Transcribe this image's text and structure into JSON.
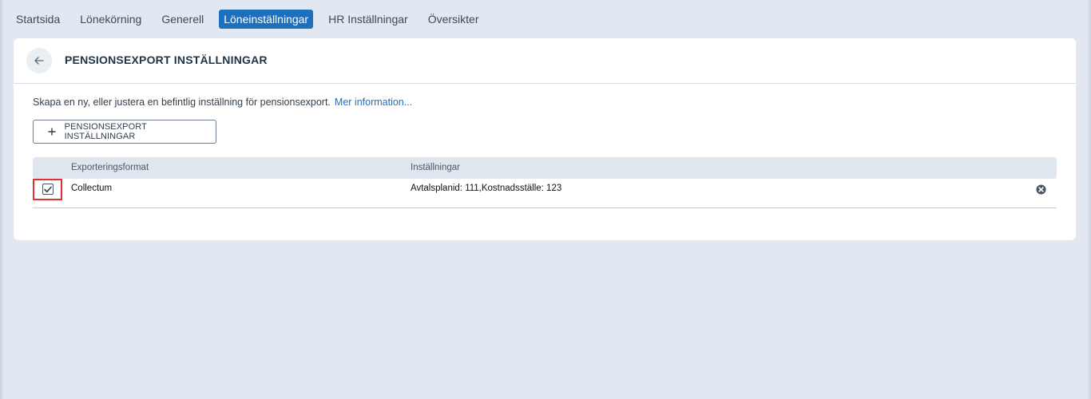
{
  "nav": {
    "items": [
      {
        "label": "Startsida"
      },
      {
        "label": "Lönekörning"
      },
      {
        "label": "Generell"
      },
      {
        "label": "Löneinställningar"
      },
      {
        "label": "HR Inställningar"
      },
      {
        "label": "Översikter"
      }
    ],
    "active_index": 3
  },
  "header": {
    "back_icon": "arrow-left-icon",
    "title": "PENSIONSEXPORT INSTÄLLNINGAR"
  },
  "description": {
    "text": "Skapa en ny, eller justera en befintlig inställning för pensionsexport.",
    "link_label": "Mer information..."
  },
  "add_button": {
    "icon": "plus-icon",
    "label": "PENSIONSEXPORT INSTÄLLNINGAR"
  },
  "table": {
    "columns": [
      "Exporteringsformat",
      "Inställningar"
    ],
    "rows": [
      {
        "checked": true,
        "format": "Collectum",
        "settings": "Avtalsplanid: 111,Kostnadsställe: 123",
        "remove_icon": "close-circle-icon"
      }
    ]
  },
  "colors": {
    "accent": "#1e6fbe",
    "background": "#e1e8f1",
    "highlight": "#e03131"
  }
}
